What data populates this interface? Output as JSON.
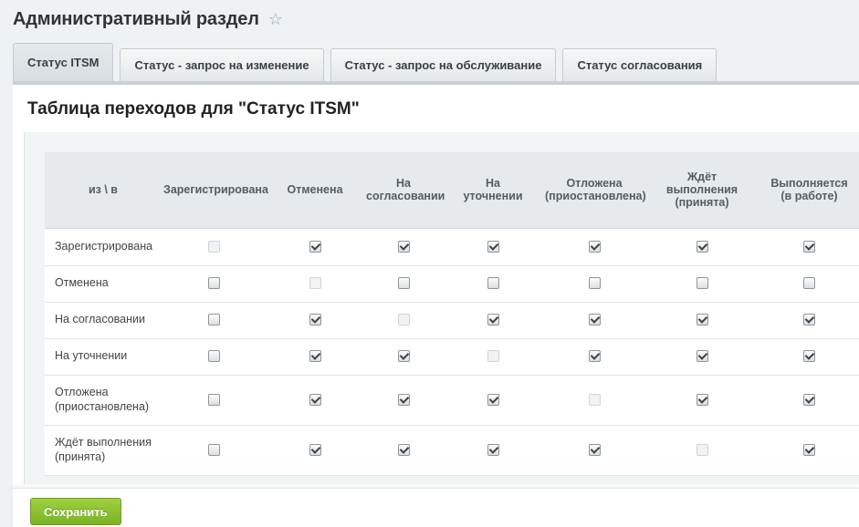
{
  "header": {
    "title": "Административный раздел",
    "star_icon": "☆"
  },
  "tabs": [
    {
      "label": "Статус ITSM",
      "active": true
    },
    {
      "label": "Статус - запрос на изменение",
      "active": false
    },
    {
      "label": "Статус - запрос на обслуживание",
      "active": false
    },
    {
      "label": "Статус согласования",
      "active": false
    }
  ],
  "panel": {
    "title": "Таблица переходов для \"Статус ITSM\""
  },
  "matrix": {
    "corner": "из \\ в",
    "columns": [
      "Зарегистрирована",
      "Отменена",
      "На согласовании",
      "На уточнении",
      "Отложена (приостановлена)",
      "Ждёт выполнения (принята)",
      "Выполняется (в работе)"
    ],
    "column_lines": [
      [
        "Зарегистрирована"
      ],
      [
        "Отменена"
      ],
      [
        "На",
        "согласовании"
      ],
      [
        "На",
        "уточнении"
      ],
      [
        "Отложена",
        "(приостановлена)"
      ],
      [
        "Ждёт",
        "выполнения",
        "(принята)"
      ],
      [
        "Выполняется",
        "(в работе)"
      ]
    ],
    "rows": [
      {
        "label_lines": [
          "Зарегистрирована"
        ],
        "cells": [
          "disabled",
          true,
          true,
          true,
          true,
          true,
          true
        ]
      },
      {
        "label_lines": [
          "Отменена"
        ],
        "cells": [
          false,
          "disabled",
          false,
          false,
          false,
          false,
          false
        ]
      },
      {
        "label_lines": [
          "На согласовании"
        ],
        "cells": [
          false,
          true,
          "disabled",
          true,
          true,
          true,
          true
        ]
      },
      {
        "label_lines": [
          "На уточнении"
        ],
        "cells": [
          false,
          true,
          true,
          "disabled",
          true,
          true,
          true
        ]
      },
      {
        "label_lines": [
          "Отложена",
          "(приостановлена)"
        ],
        "cells": [
          false,
          true,
          true,
          true,
          "disabled",
          true,
          true
        ]
      },
      {
        "label_lines": [
          "Ждёт выполнения",
          "(принята)"
        ],
        "cells": [
          false,
          true,
          true,
          true,
          true,
          "disabled",
          true
        ]
      }
    ]
  },
  "footer": {
    "save_label": "Сохранить"
  },
  "colors": {
    "accent_green": "#7bb225",
    "tab_bg": "#e6eaec",
    "panel_border": "#c9d1d6"
  }
}
